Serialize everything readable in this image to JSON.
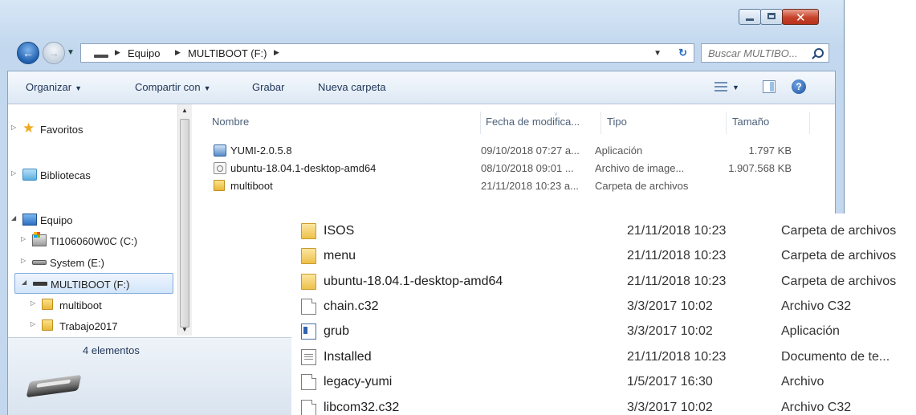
{
  "address": {
    "crumbs": [
      "Equipo",
      "MULTIBOOT (F:)"
    ],
    "search_placeholder": "Buscar MULTIBO..."
  },
  "toolbar": {
    "organize": "Organizar",
    "share": "Compartir con",
    "burn": "Grabar",
    "new_folder": "Nueva carpeta"
  },
  "navigation": {
    "favorites": "Favoritos",
    "libraries": "Bibliotecas",
    "computer": "Equipo",
    "drive_c": "TI106060W0C (C:)",
    "drive_e": "System (E:)",
    "drive_f": "MULTIBOOT (F:)",
    "folder_multiboot": "multiboot",
    "folder_trabajo": "Trabajo2017"
  },
  "columns": {
    "name": "Nombre",
    "date": "Fecha de modifica...",
    "type": "Tipo",
    "size": "Tamaño"
  },
  "files": [
    {
      "name": "YUMI-2.0.5.8",
      "date": "09/10/2018 07:27 a...",
      "type": "Aplicación",
      "size": "1.797 KB",
      "icon": "app-icon"
    },
    {
      "name": "ubuntu-18.04.1-desktop-amd64",
      "date": "08/10/2018 09:01 ...",
      "type": "Archivo de image...",
      "size": "1.907.568 KB",
      "icon": "disc-image-icon"
    },
    {
      "name": "multiboot",
      "date": "21/11/2018 10:23 a...",
      "type": "Carpeta de archivos",
      "size": "",
      "icon": "folder-icon"
    }
  ],
  "details": {
    "count": "4 elementos"
  },
  "overlay_files": [
    {
      "name": "ISOS",
      "date": "21/11/2018 10:23",
      "type": "Carpeta de archivos",
      "icon": "folder-icon"
    },
    {
      "name": "menu",
      "date": "21/11/2018 10:23",
      "type": "Carpeta de archivos",
      "icon": "folder-icon"
    },
    {
      "name": "ubuntu-18.04.1-desktop-amd64",
      "date": "21/11/2018 10:23",
      "type": "Carpeta de archivos",
      "icon": "folder-icon"
    },
    {
      "name": "chain.c32",
      "date": "3/3/2017 10:02",
      "type": "Archivo C32",
      "icon": "file-icon"
    },
    {
      "name": "grub",
      "date": "3/3/2017 10:02",
      "type": "Aplicación",
      "icon": "app-icon"
    },
    {
      "name": "Installed",
      "date": "21/11/2018 10:23",
      "type": "Documento de te...",
      "icon": "text-document-icon"
    },
    {
      "name": "legacy-yumi",
      "date": "1/5/2017 16:30",
      "type": "Archivo",
      "icon": "file-icon"
    },
    {
      "name": "libcom32.c32",
      "date": "3/3/2017 10:02",
      "type": "Archivo C32",
      "icon": "file-icon"
    }
  ]
}
